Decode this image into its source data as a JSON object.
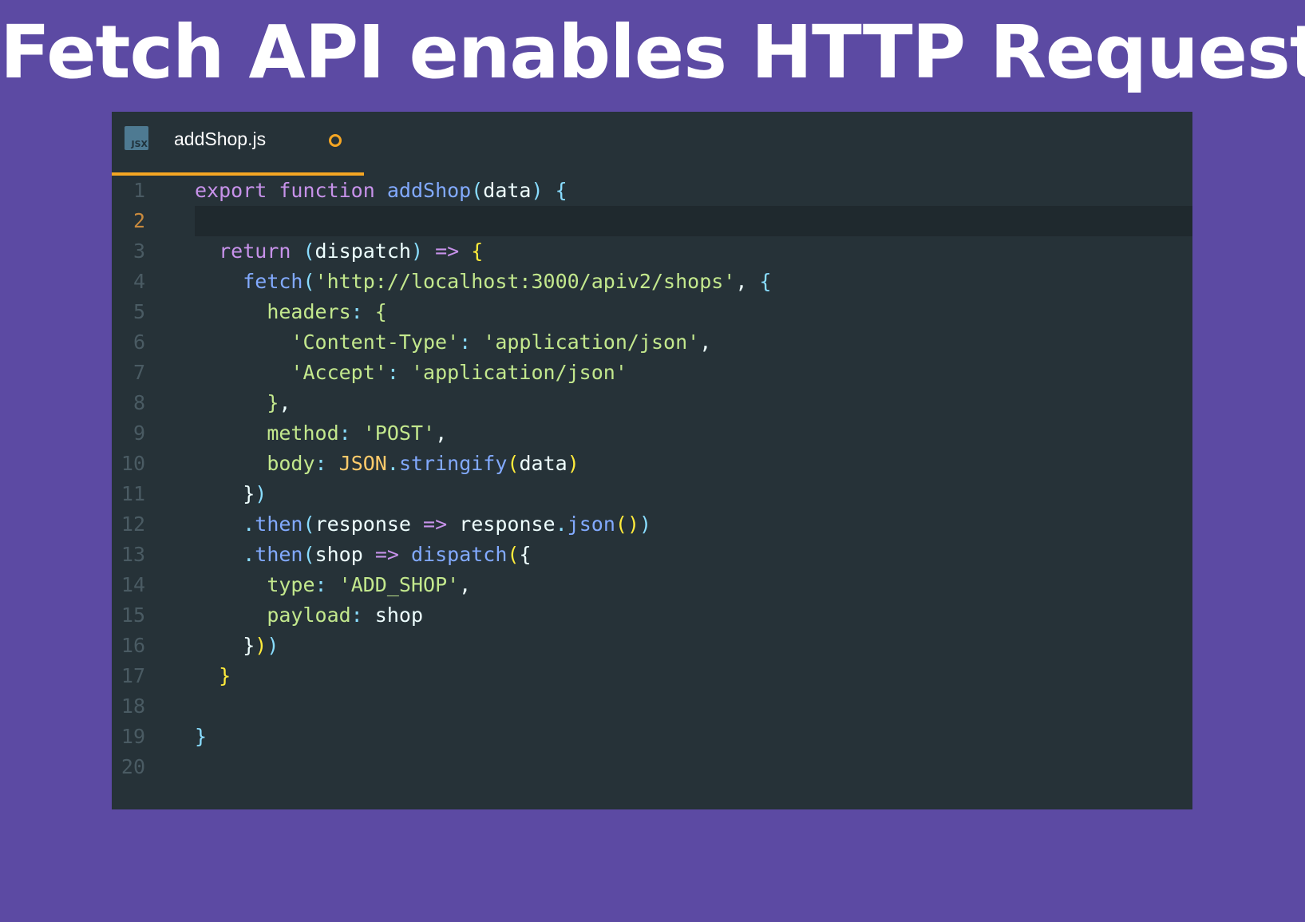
{
  "slide": {
    "title": "Fetch API enables HTTP Requests"
  },
  "editor": {
    "tab": {
      "filename": "addShop.js",
      "icon_label": "JSX",
      "icon": "jsx-file-icon",
      "modified": true
    },
    "active_line": 2,
    "colors": {
      "background": "#263238",
      "accent": "#f5a623",
      "slide_background": "#5c4aa3"
    },
    "lines": [
      {
        "number": "1",
        "tokens": [
          [
            "kw",
            "export"
          ],
          [
            "txt",
            " "
          ],
          [
            "kw",
            "function"
          ],
          [
            "txt",
            " "
          ],
          [
            "fn",
            "addShop"
          ],
          [
            "punc",
            "("
          ],
          [
            "txt",
            "data"
          ],
          [
            "punc",
            ")"
          ],
          [
            "txt",
            " "
          ],
          [
            "br2",
            "{"
          ]
        ]
      },
      {
        "number": "2",
        "tokens": []
      },
      {
        "number": "3",
        "tokens": [
          [
            "txt",
            "  "
          ],
          [
            "kw",
            "return"
          ],
          [
            "txt",
            " "
          ],
          [
            "br2",
            "("
          ],
          [
            "txt",
            "dispatch"
          ],
          [
            "br2",
            ")"
          ],
          [
            "txt",
            " "
          ],
          [
            "kw",
            "=>"
          ],
          [
            "txt",
            " "
          ],
          [
            "br1",
            "{"
          ]
        ]
      },
      {
        "number": "4",
        "tokens": [
          [
            "txt",
            "    "
          ],
          [
            "fn",
            "fetch"
          ],
          [
            "punc",
            "("
          ],
          [
            "str",
            "'http://localhost:3000/apiv2/shops'"
          ],
          [
            "txt",
            ", "
          ],
          [
            "br2",
            "{"
          ]
        ]
      },
      {
        "number": "5",
        "tokens": [
          [
            "txt",
            "      "
          ],
          [
            "prop",
            "headers"
          ],
          [
            "punc",
            ":"
          ],
          [
            "txt",
            " "
          ],
          [
            "str",
            "{"
          ]
        ]
      },
      {
        "number": "6",
        "tokens": [
          [
            "txt",
            "        "
          ],
          [
            "str",
            "'Content-Type'"
          ],
          [
            "punc",
            ":"
          ],
          [
            "txt",
            " "
          ],
          [
            "str",
            "'application/json'"
          ],
          [
            "txt",
            ","
          ]
        ]
      },
      {
        "number": "7",
        "tokens": [
          [
            "txt",
            "        "
          ],
          [
            "str",
            "'Accept'"
          ],
          [
            "punc",
            ":"
          ],
          [
            "txt",
            " "
          ],
          [
            "str",
            "'application/json'"
          ]
        ]
      },
      {
        "number": "8",
        "tokens": [
          [
            "txt",
            "      "
          ],
          [
            "str",
            "}"
          ],
          [
            "txt",
            ","
          ]
        ]
      },
      {
        "number": "9",
        "tokens": [
          [
            "txt",
            "      "
          ],
          [
            "prop",
            "method"
          ],
          [
            "punc",
            ":"
          ],
          [
            "txt",
            " "
          ],
          [
            "str",
            "'POST'"
          ],
          [
            "txt",
            ","
          ]
        ]
      },
      {
        "number": "10",
        "tokens": [
          [
            "txt",
            "      "
          ],
          [
            "prop",
            "body"
          ],
          [
            "punc",
            ":"
          ],
          [
            "txt",
            " "
          ],
          [
            "cls",
            "JSON"
          ],
          [
            "punc",
            "."
          ],
          [
            "fn",
            "stringify"
          ],
          [
            "br1",
            "("
          ],
          [
            "txt",
            "data"
          ],
          [
            "br1",
            ")"
          ]
        ]
      },
      {
        "number": "11",
        "tokens": [
          [
            "txt",
            "    "
          ],
          [
            "txt",
            "}"
          ],
          [
            "punc",
            ")"
          ]
        ]
      },
      {
        "number": "12",
        "tokens": [
          [
            "txt",
            "    "
          ],
          [
            "punc",
            "."
          ],
          [
            "fn",
            "then"
          ],
          [
            "punc",
            "("
          ],
          [
            "txt",
            "response "
          ],
          [
            "kw",
            "=>"
          ],
          [
            "txt",
            " response"
          ],
          [
            "punc",
            "."
          ],
          [
            "fn",
            "json"
          ],
          [
            "br1",
            "()"
          ],
          [
            "punc",
            ")"
          ]
        ]
      },
      {
        "number": "13",
        "tokens": [
          [
            "txt",
            "    "
          ],
          [
            "punc",
            "."
          ],
          [
            "fn",
            "then"
          ],
          [
            "punc",
            "("
          ],
          [
            "txt",
            "shop "
          ],
          [
            "kw",
            "=>"
          ],
          [
            "txt",
            " "
          ],
          [
            "fn",
            "dispatch"
          ],
          [
            "br1",
            "("
          ],
          [
            "txt",
            "{"
          ]
        ]
      },
      {
        "number": "14",
        "tokens": [
          [
            "txt",
            "      "
          ],
          [
            "prop",
            "type"
          ],
          [
            "punc",
            ":"
          ],
          [
            "txt",
            " "
          ],
          [
            "str",
            "'ADD_SHOP'"
          ],
          [
            "txt",
            ","
          ]
        ]
      },
      {
        "number": "15",
        "tokens": [
          [
            "txt",
            "      "
          ],
          [
            "prop",
            "payload"
          ],
          [
            "punc",
            ":"
          ],
          [
            "txt",
            " shop"
          ]
        ]
      },
      {
        "number": "16",
        "tokens": [
          [
            "txt",
            "    "
          ],
          [
            "txt",
            "}"
          ],
          [
            "br1",
            ")"
          ],
          [
            "punc",
            ")"
          ]
        ]
      },
      {
        "number": "17",
        "tokens": [
          [
            "txt",
            "  "
          ],
          [
            "br1",
            "}"
          ]
        ]
      },
      {
        "number": "18",
        "tokens": []
      },
      {
        "number": "19",
        "tokens": [
          [
            "br2",
            "}"
          ]
        ]
      },
      {
        "number": "20",
        "tokens": []
      }
    ]
  }
}
